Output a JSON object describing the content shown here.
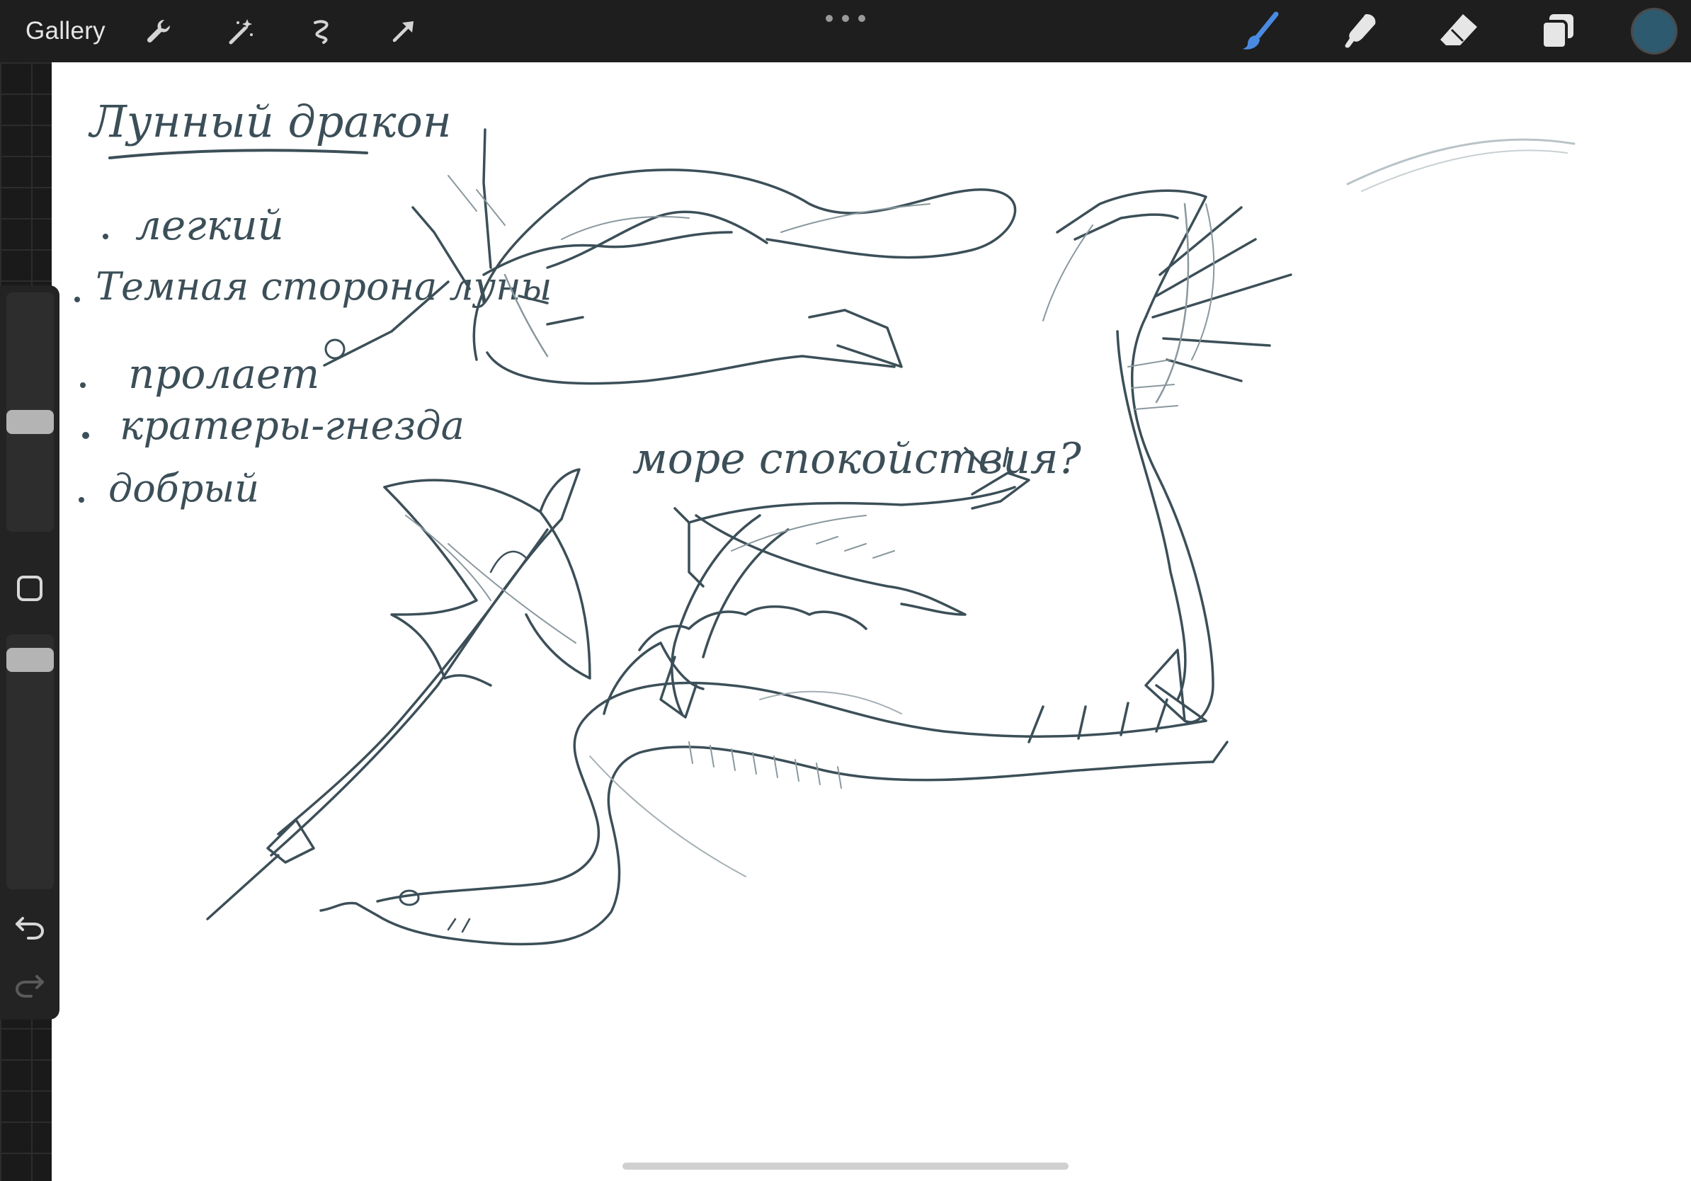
{
  "toolbar": {
    "gallery_label": "Gallery",
    "left_tools": [
      "wrench-icon",
      "magic-wand-icon",
      "selection-icon",
      "transform-arrow-icon"
    ],
    "right_tools": [
      "brush-icon",
      "smudge-icon",
      "eraser-icon",
      "layers-icon"
    ],
    "active_tool": "brush",
    "accent_color": "#4a8ae0",
    "current_color": "#2e5a70"
  },
  "sidebar": {
    "brush_size_level": 0.45,
    "opacity_level": 0.22,
    "buttons": [
      "modify-icon",
      "undo-icon",
      "redo-icon"
    ]
  },
  "canvas": {
    "ink_color": "#3c4f58",
    "notes": {
      "title": "Лунный дракон",
      "items": [
        "легкий",
        "Темная сторона луны",
        "пролает",
        "кратеры-гнезда",
        "добрый"
      ],
      "caption": "море спокойствия?"
    },
    "sketches": [
      "dragon-sketch-curled",
      "dragon-sketch-seahorse",
      "dragon-sketch-flying",
      "dragon-sketch-swimming",
      "dragon-sketch-serpent"
    ]
  }
}
